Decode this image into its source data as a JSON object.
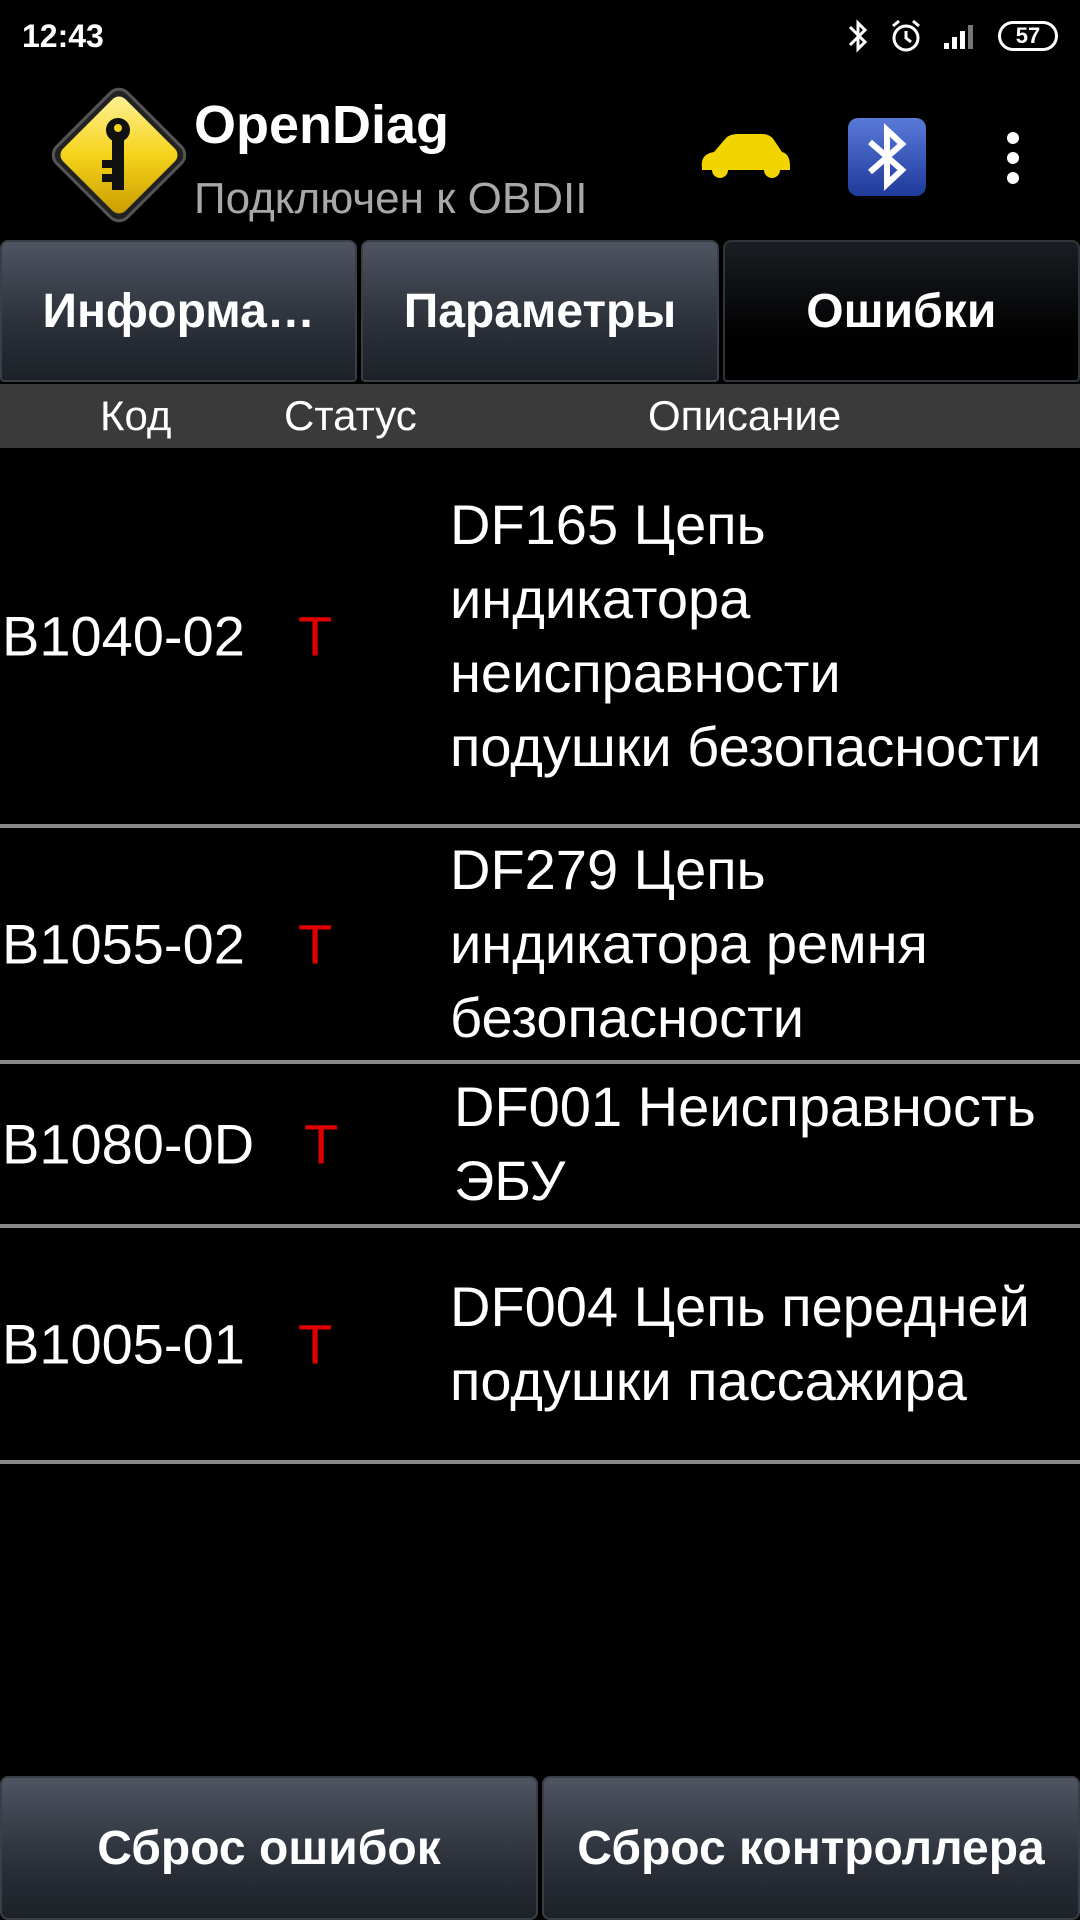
{
  "status_bar": {
    "time": "12:43",
    "battery": "57",
    "icons": [
      "bluetooth-icon",
      "alarm-icon",
      "signal-icon",
      "battery-icon"
    ]
  },
  "action_bar": {
    "title": "OpenDiag",
    "subtitle": "Подключен к OBDII",
    "icons": [
      "app-logo-key-icon",
      "car-icon",
      "bluetooth-adapter-icon",
      "overflow-menu-icon"
    ]
  },
  "tabs": [
    {
      "label": "Информа…",
      "active": false
    },
    {
      "label": "Параметры",
      "active": false
    },
    {
      "label": "Ошибки",
      "active": true
    }
  ],
  "table": {
    "headers": {
      "code": "Код",
      "status": "Статус",
      "description": "Описание"
    },
    "rows": [
      {
        "code": "B1040-02",
        "status": "T",
        "description": "DF165 Цепь индикатора неисправности подушки безопасности"
      },
      {
        "code": "B1055-02",
        "status": "T",
        "description": "DF279 Цепь индикатора ремня безопасности"
      },
      {
        "code": "B1080-0D",
        "status": "T",
        "description": "DF001 Неисправность ЭБУ"
      },
      {
        "code": "B1005-01",
        "status": "T",
        "description": "DF004 Цепь передней подушки пассажира"
      }
    ]
  },
  "buttons": {
    "reset_errors": "Сброс ошибок",
    "reset_controller": "Сброс контроллера"
  },
  "colors": {
    "status_text": "#e00000",
    "car_icon": "#f2d500",
    "logo_yellow": "#f5d31a"
  }
}
